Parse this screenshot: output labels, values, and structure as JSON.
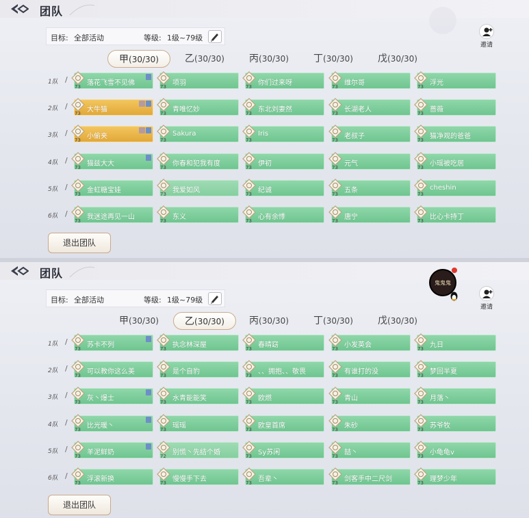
{
  "colors": {
    "slot_green": "#7ccd9b",
    "slot_gold": "#eab84a",
    "accent_border": "#c9ab8b",
    "red_dot": "#e0362c"
  },
  "icons": {
    "back": "back-arrow-diamond-icon",
    "edit": "pen-icon",
    "invite": "add-person-icon",
    "emblem": "level-emblem-icon",
    "qq": "penguin-icon"
  },
  "panels": [
    {
      "header": {
        "title": "团队"
      },
      "target_label": "目标:",
      "target_value": "全部活动",
      "level_label": "等级:",
      "level_value": "1级~79级",
      "invite_label": "邀请",
      "avatar_text": "",
      "tabs": [
        {
          "char": "甲",
          "count": "(30/30)"
        },
        {
          "char": "乙",
          "count": "(30/30)"
        },
        {
          "char": "丙",
          "count": "(30/30)"
        },
        {
          "char": "丁",
          "count": "(30/30)"
        },
        {
          "char": "戊",
          "count": "(30/30)"
        }
      ],
      "active_tab": 0,
      "teams": [
        {
          "label": "1队",
          "members": [
            {
              "name": "落花飞雪不见佛",
              "level": "73"
            },
            {
              "name": "项羽",
              "level": "73"
            },
            {
              "name": "你们过来呀",
              "level": "73"
            },
            {
              "name": "维尔哥",
              "level": "73"
            },
            {
              "name": "浮光",
              "level": "73"
            }
          ]
        },
        {
          "label": "2队",
          "members": [
            {
              "name": "大牛猫",
              "level": "73"
            },
            {
              "name": "青唯忆妙",
              "level": "73"
            },
            {
              "name": "东北刘妻然",
              "level": "73"
            },
            {
              "name": "长湖老人",
              "level": "73"
            },
            {
              "name": "蔷薇",
              "level": "73"
            }
          ]
        },
        {
          "label": "3队",
          "members": [
            {
              "name": "小偷夹",
              "level": "73"
            },
            {
              "name": "Sakura",
              "level": "73"
            },
            {
              "name": "Iris",
              "level": "73"
            },
            {
              "name": "老叔子",
              "level": "73"
            },
            {
              "name": "猫净观的爸爸",
              "level": "73"
            }
          ]
        },
        {
          "label": "4队",
          "members": [
            {
              "name": "猫兹大大",
              "level": "73"
            },
            {
              "name": "你春和犯我有度",
              "level": "73"
            },
            {
              "name": "伊初",
              "level": "73"
            },
            {
              "name": "元气",
              "level": "73"
            },
            {
              "name": "小瑶被吃居",
              "level": "73"
            }
          ]
        },
        {
          "label": "5队",
          "members": [
            {
              "name": "金虹糖宝娃",
              "level": "73"
            },
            {
              "name": "我爱如风",
              "level": "73"
            },
            {
              "name": "纪诚",
              "level": "73"
            },
            {
              "name": "五条",
              "level": "73"
            },
            {
              "name": "cheshin",
              "level": "73"
            }
          ]
        },
        {
          "label": "6队",
          "members": [
            {
              "name": "我迷途再见一山",
              "level": "73"
            },
            {
              "name": "东义",
              "level": "73"
            },
            {
              "name": "心有余悸",
              "level": "73"
            },
            {
              "name": "唐宁",
              "level": "73"
            },
            {
              "name": "比心卡持丁",
              "level": "73"
            }
          ]
        }
      ],
      "exit_label": "退出团队"
    },
    {
      "header": {
        "title": "团队"
      },
      "target_label": "目标:",
      "target_value": "全部活动",
      "level_label": "等级:",
      "level_value": "1级~79级",
      "invite_label": "邀请",
      "avatar_text": "鬼鬼鬼",
      "tabs": [
        {
          "char": "甲",
          "count": "(30/30)"
        },
        {
          "char": "乙",
          "count": "(30/30)"
        },
        {
          "char": "丙",
          "count": "(30/30)"
        },
        {
          "char": "丁",
          "count": "(30/30)"
        },
        {
          "char": "戊",
          "count": "(30/30)"
        }
      ],
      "active_tab": 1,
      "teams": [
        {
          "label": "1队",
          "members": [
            {
              "name": "苏卡不列",
              "level": "73"
            },
            {
              "name": "执念林深屋",
              "level": "73"
            },
            {
              "name": "春晴窈",
              "level": "73"
            },
            {
              "name": "小发英会",
              "level": "73"
            },
            {
              "name": "九日",
              "level": "73"
            }
          ]
        },
        {
          "label": "2队",
          "members": [
            {
              "name": "可以教你这么美",
              "level": "73"
            },
            {
              "name": "是个自豹",
              "level": "73"
            },
            {
              "name": "、、拥抱、、敬畏",
              "level": "73"
            },
            {
              "name": "有谁打的没",
              "level": "73"
            },
            {
              "name": "梦回半夏",
              "level": "73"
            }
          ]
        },
        {
          "label": "3队",
          "members": [
            {
              "name": "灰丶爆士",
              "level": "73"
            },
            {
              "name": "水青能能笑",
              "level": "73"
            },
            {
              "name": "欧燃",
              "level": "73"
            },
            {
              "name": "青山",
              "level": "73"
            },
            {
              "name": "月落丶",
              "level": "73"
            }
          ]
        },
        {
          "label": "4队",
          "members": [
            {
              "name": "比光暖丶",
              "level": "73"
            },
            {
              "name": "瑶瑶",
              "level": "73"
            },
            {
              "name": "欧皇首席",
              "level": "73"
            },
            {
              "name": "朱砂",
              "level": "73"
            },
            {
              "name": "苏爷牧",
              "level": "73"
            }
          ]
        },
        {
          "label": "5队",
          "members": [
            {
              "name": "羊泥鲜奶",
              "level": "73"
            },
            {
              "name": "别慌丶先结个婚",
              "level": "72"
            },
            {
              "name": "Sy苏闲",
              "level": "73"
            },
            {
              "name": "喆丶",
              "level": "73"
            },
            {
              "name": "小龟龟v",
              "level": "73"
            }
          ]
        },
        {
          "label": "6队",
          "members": [
            {
              "name": "浮滚新换",
              "level": "73"
            },
            {
              "name": "慢慢手下去",
              "level": "73"
            },
            {
              "name": "吾辈丶",
              "level": "73"
            },
            {
              "name": "剑客手中二尺剑",
              "level": "73"
            },
            {
              "name": "理梦少年",
              "level": "73"
            }
          ]
        }
      ],
      "exit_label": "退出团队"
    }
  ]
}
